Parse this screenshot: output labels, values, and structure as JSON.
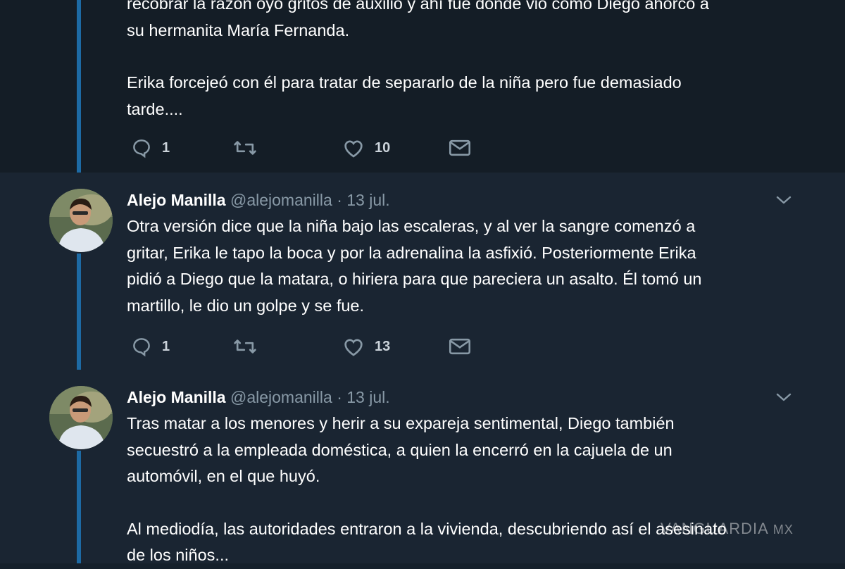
{
  "tweets": [
    {
      "lines": [
        "recobrar la razón oyó gritos de auxilio y ahí fue donde vio como Diego ahorcó a",
        "su hermanita María Fernanda.",
        "",
        "Erika forcejeó con él para tratar de separarlo de la niña pero fue demasiado",
        "tarde...."
      ],
      "replies": "1",
      "likes": "10"
    },
    {
      "name": "Alejo Manilla",
      "handle": "@alejomanilla",
      "separator": "·",
      "date": "13 jul.",
      "lines": [
        "Otra versión dice que la niña bajo las escaleras, y al ver la sangre comenzó a",
        "gritar, Erika le tapo la boca y por la adrenalina la asfixió. Posteriormente Erika",
        "pidió a Diego que la matara, o hiriera para que pareciera un asalto. Él tomó un",
        "martillo, le dio un golpe y se fue."
      ],
      "replies": "1",
      "likes": "13"
    },
    {
      "name": "Alejo Manilla",
      "handle": "@alejomanilla",
      "separator": "·",
      "date": "13 jul.",
      "lines": [
        "Tras matar a los menores y herir a su expareja sentimental, Diego también",
        "secuestró a la empleada doméstica, a quien la encerró en la cajuela de un",
        "automóvil, en el que huyó.",
        "",
        "Al mediodía, las autoridades entraron a la vivienda, descubriendo así el asesinato",
        "de los niños..."
      ]
    }
  ],
  "watermark": {
    "brand": "VANGUARDIA",
    "suffix": "MX"
  },
  "icons": {
    "reply": "reply-icon",
    "retweet": "retweet-icon",
    "like": "heart-icon",
    "dm": "envelope-icon",
    "caret": "chevron-down-icon"
  },
  "colors": {
    "background": "#15202b",
    "thread_line": "#1d6aa4",
    "secondary_text": "#8899a6"
  }
}
